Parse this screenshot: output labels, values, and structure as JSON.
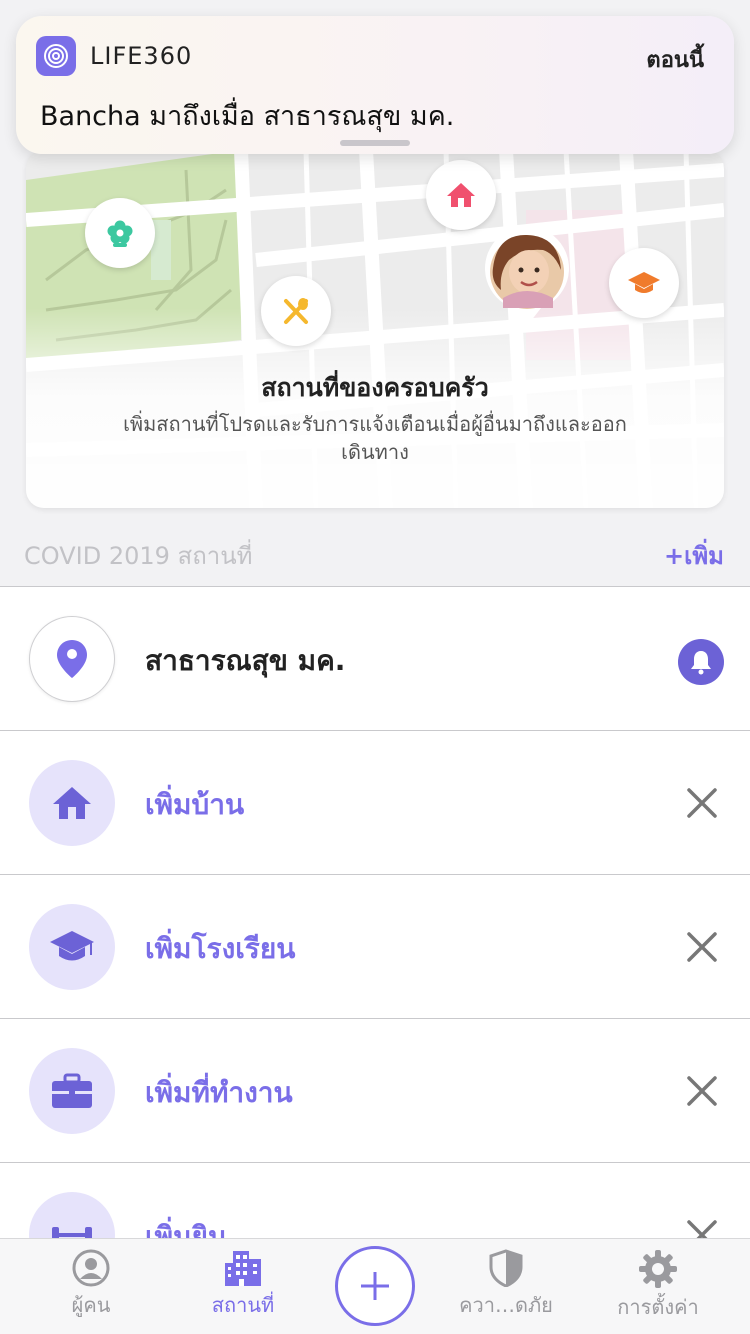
{
  "notification": {
    "app_name": "LIFE360",
    "time": "ตอนนี้",
    "message": "Bancha มาถึงเมื่อ สาธารณสุข มค."
  },
  "map_card": {
    "title": "สถานที่ของครอบครัว",
    "subtitle_line1": "เพิ่มสถานที่โปรดและรับการแจ้งเตือนเมื่อผู้อื่นมาถึงและออก",
    "subtitle_line2": "เดินทาง",
    "pins": [
      "flower-icon",
      "home-icon",
      "food-icon",
      "school-icon",
      "avatar"
    ]
  },
  "section": {
    "header": "COVID 2019 สถานที่",
    "add_label": "+เพิ่ม"
  },
  "places": [
    {
      "label": "สาธารณสุข มค.",
      "icon": "location-pin-icon",
      "action": "bell-icon"
    },
    {
      "label": "เพิ่มบ้าน",
      "icon": "home-icon",
      "action": "close-icon"
    },
    {
      "label": "เพิ่มโรงเรียน",
      "icon": "graduation-cap-icon",
      "action": "close-icon"
    },
    {
      "label": "เพิ่มที่ทำงาน",
      "icon": "briefcase-icon",
      "action": "close-icon"
    },
    {
      "label": "เพิ่มยิม",
      "icon": "dumbbell-icon",
      "action": "close-icon"
    }
  ],
  "tabbar": {
    "people": "ผู้คน",
    "places": "สถานที่",
    "safety": "ควา…ดภัย",
    "settings": "การตั้งค่า",
    "active": "places"
  },
  "colors": {
    "accent": "#7a6ee8",
    "home_pin": "#f0506e",
    "flower_pin": "#3cc8a0",
    "food_pin": "#f5b82e",
    "school_pin": "#f07b2c"
  }
}
